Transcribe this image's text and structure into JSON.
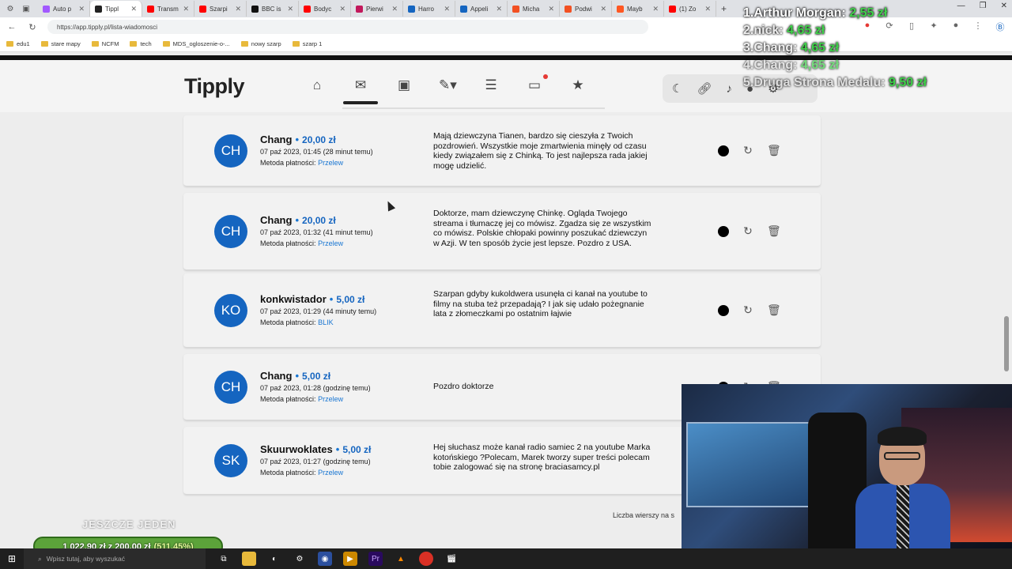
{
  "browser": {
    "tabs": [
      {
        "label": "Auto p",
        "color": "#a259ff"
      },
      {
        "label": "Tippl",
        "color": "#222222",
        "active": true
      },
      {
        "label": "Transm",
        "color": "#ff0000"
      },
      {
        "label": "Szarpi",
        "color": "#ff0000"
      },
      {
        "label": "BBC is",
        "color": "#111111"
      },
      {
        "label": "Bodyc",
        "color": "#ff0000"
      },
      {
        "label": "Pierwi",
        "color": "#c2185b"
      },
      {
        "label": "Harro",
        "color": "#1565c0"
      },
      {
        "label": "Appeli",
        "color": "#1565c0"
      },
      {
        "label": "Micha",
        "color": "#f25022"
      },
      {
        "label": "Podwi",
        "color": "#f25022"
      },
      {
        "label": "Mayb",
        "color": "#ff5722"
      },
      {
        "label": "(1) Zo",
        "color": "#ff0000"
      }
    ],
    "url": "https://app.tipply.pl/lista-wiadomosci",
    "bookmarks": [
      "edu1",
      "stare mapy",
      "NCFM",
      "tech",
      "MDS_ogloszenie-o-...",
      "nowy szarp",
      "szarp 1"
    ]
  },
  "site": {
    "logo": "Tipply",
    "nav_icons": [
      "home-icon",
      "inbox-icon",
      "wallet-icon",
      "edit-icon",
      "list-icon",
      "window-icon",
      "star-icon"
    ]
  },
  "ranking": [
    {
      "name": "1.Arthur Morgan:",
      "value": "2,55 zł"
    },
    {
      "name": "2.nick:",
      "value": "4,65 zł"
    },
    {
      "name": "3.Chang:",
      "value": "4,65 zł"
    },
    {
      "name": "4.Chang:",
      "value": "4,65 zł"
    },
    {
      "name": "5.Druga Strona Medalu:",
      "value": "9,50 zł"
    }
  ],
  "messages": [
    {
      "initials": "CH",
      "name": "Chang",
      "amount": "20,00 zł",
      "date": "07 paź 2023, 01:45 (28 minut temu)",
      "method_label": "Metoda płatności:",
      "method": "Przelew",
      "text": "Mają dziewczyna Tianen, bardzo się cieszyła z Twoich pozdrowień. Wszystkie moje zmartwienia minęły od czasu kiedy związałem się z Chinką. To jest najlepsza rada jakiej mogę udzielić."
    },
    {
      "initials": "CH",
      "name": "Chang",
      "amount": "20,00 zł",
      "date": "07 paź 2023, 01:32 (41 minut temu)",
      "method_label": "Metoda płatności:",
      "method": "Przelew",
      "text": "Doktorze, mam dziewczynę Chinkę. Ogląda Twojego streama i tłumaczę jej co mówisz. Zgadza się ze wszystkim co mówisz. Polskie chłopaki powinny poszukać dziewczyn w Azji. W ten sposób życie jest lepsze. Pozdro z USA."
    },
    {
      "initials": "KO",
      "name": "konkwistador",
      "amount": "5,00 zł",
      "date": "07 paź 2023, 01:29 (44 minuty temu)",
      "method_label": "Metoda płatności:",
      "method": "BLIK",
      "text": "Szarpan gdyby kukoldwera usunęła ci kanał na youtube to filmy na stuba też przepadają? I jak się udało pożegnanie lata z złomeczkami po ostatnim łajwie"
    },
    {
      "initials": "CH",
      "name": "Chang",
      "amount": "5,00 zł",
      "date": "07 paź 2023, 01:28 (godzinę temu)",
      "method_label": "Metoda płatności:",
      "method": "Przelew",
      "text": "Pozdro doktorze"
    },
    {
      "initials": "SK",
      "name": "Skuurwoklates",
      "amount": "5,00 zł",
      "date": "07 paź 2023, 01:27 (godzinę temu)",
      "method_label": "Metoda płatności:",
      "method": "Przelew",
      "text": "Hej słuchasz może kanał radio samiec 2 na youtube Marka kotońskiego ?Polecam, Marek tworzy super treści polecam tobie zalogować się na stronę braciasamcy.pl"
    }
  ],
  "footer": {
    "rows_label": "Liczba wierszy na s"
  },
  "goal": {
    "text": "JESZCZE JEDEN",
    "amount": "1 022,90 zł z 200,00 zł",
    "percent": "(511.45%)"
  },
  "taskbar": {
    "search_placeholder": "Wpisz tutaj, aby wyszukać"
  }
}
